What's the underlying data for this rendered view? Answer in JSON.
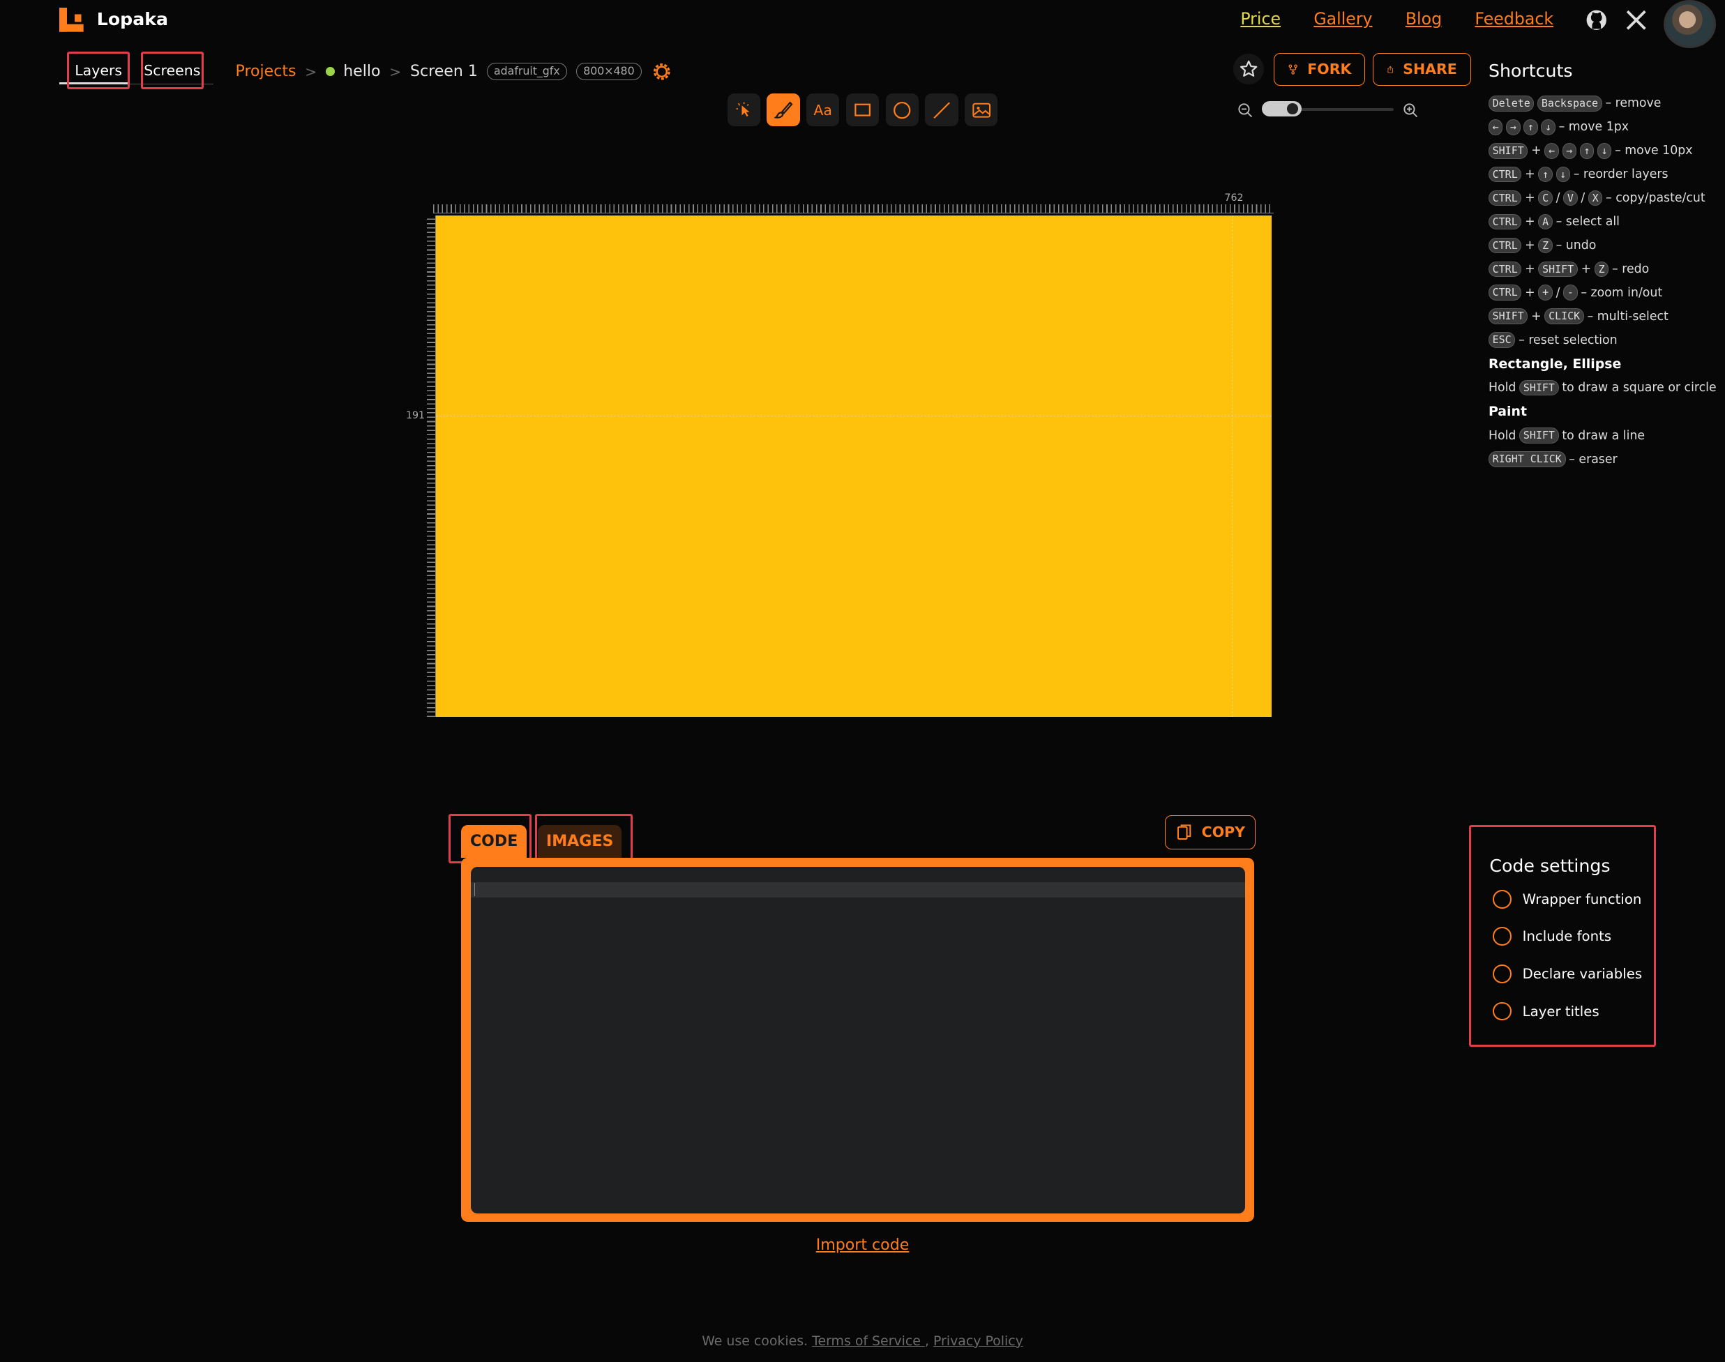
{
  "brand": {
    "name": "Lopaka",
    "accent": "#ff7d1a",
    "canvas_color": "#fec20c"
  },
  "nav": {
    "price": "Price",
    "gallery": "Gallery",
    "blog": "Blog",
    "feedback": "Feedback"
  },
  "left_tabs": {
    "layers": "Layers",
    "screens": "Screens"
  },
  "breadcrumb": {
    "projects": "Projects",
    "project": "hello",
    "screen": "Screen 1",
    "library": "adafruit_gfx",
    "resolution": "800×480"
  },
  "actions": {
    "fork": "FORK",
    "share": "SHARE",
    "copy": "COPY"
  },
  "tools": [
    {
      "icon": "select-icon"
    },
    {
      "icon": "paint-brush-icon"
    },
    {
      "label": "Aa",
      "icon": "text-icon"
    },
    {
      "icon": "rectangle-icon"
    },
    {
      "icon": "ellipse-icon"
    },
    {
      "icon": "line-icon"
    },
    {
      "icon": "image-icon"
    }
  ],
  "canvas": {
    "ruler_x": "762",
    "ruler_y": "191"
  },
  "shortcuts": {
    "title": "Shortcuts",
    "keys": {
      "delete": "Delete",
      "backspace": "Backspace",
      "shift": "SHIFT",
      "ctrl": "CTRL",
      "left": "←",
      "right": "→",
      "up": "↑",
      "down": "↓",
      "c": "C",
      "v": "V",
      "x": "X",
      "a": "A",
      "z": "Z",
      "plus": "+",
      "minus": "-",
      "click": "CLICK",
      "esc": "ESC",
      "right_click": "RIGHT CLICK"
    },
    "desc": {
      "remove": "– remove",
      "move1": "– move 1px",
      "move10": "– move 10px",
      "reorder": "– reorder layers",
      "copy": "– copy/paste/cut",
      "select_all": "– select all",
      "undo": "– undo",
      "redo": "– redo",
      "zoom": "– zoom in/out",
      "multi": "– multi-select",
      "reset": "– reset selection",
      "eraser": "– eraser"
    },
    "rect_title": "Rectangle, Ellipse",
    "hold": "Hold",
    "rect_text": "to draw a square or circle",
    "paint_title": "Paint",
    "paint_text": "to draw a line"
  },
  "code_tabs": {
    "code": "CODE",
    "images": "IMAGES"
  },
  "import_code": "Import code",
  "code_settings": {
    "title": "Code settings",
    "options": [
      "Wrapper function",
      "Include fonts",
      "Declare variables",
      "Layer titles"
    ]
  },
  "footer": {
    "text": "We use cookies.",
    "terms": "Terms of Service ",
    "sep": ",",
    "privacy": "Privacy Policy"
  }
}
